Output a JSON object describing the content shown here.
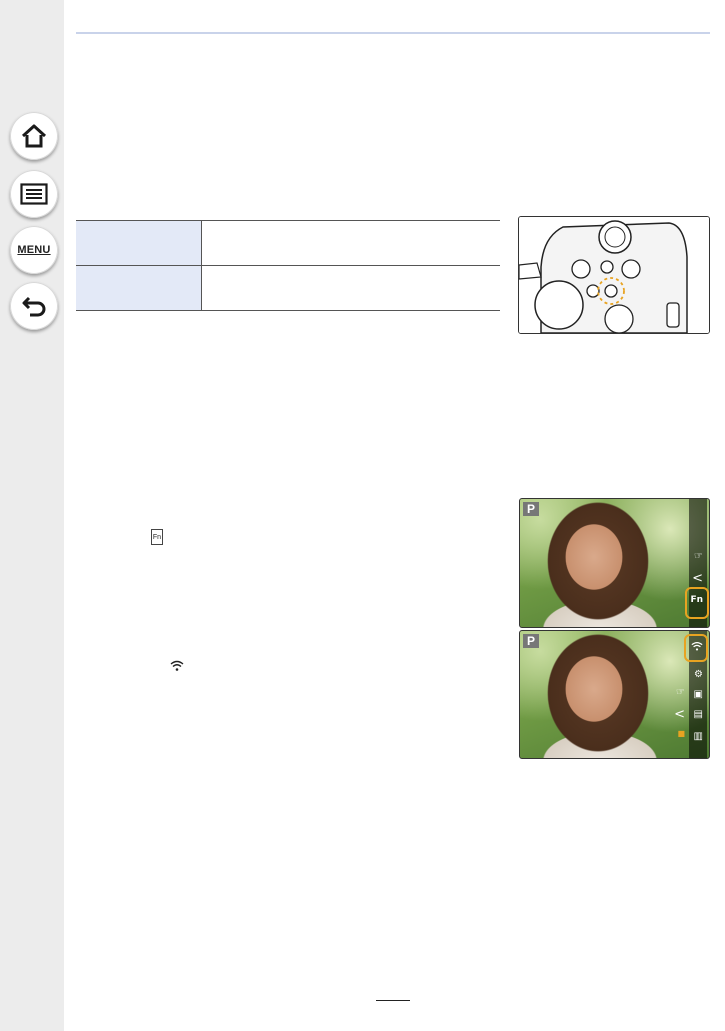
{
  "sidebar": {
    "buttons": [
      {
        "name": "home-icon"
      },
      {
        "name": "contents-icon"
      },
      {
        "name": "menu-icon",
        "label": "MENU"
      },
      {
        "name": "back-icon"
      }
    ]
  },
  "table": {
    "rows": [
      {
        "key": "",
        "value": ""
      },
      {
        "key": "",
        "value": ""
      }
    ]
  },
  "photos": {
    "scene_mode": "P",
    "inline_fn_label": "Fn",
    "icons": [
      "fn-icon",
      "wifi-icon"
    ]
  },
  "colors": {
    "sidebar_bg": "#ececec",
    "header_line": "#c9d3ea",
    "table_key_bg": "#e3e9f7",
    "highlight": "#e8a321"
  }
}
